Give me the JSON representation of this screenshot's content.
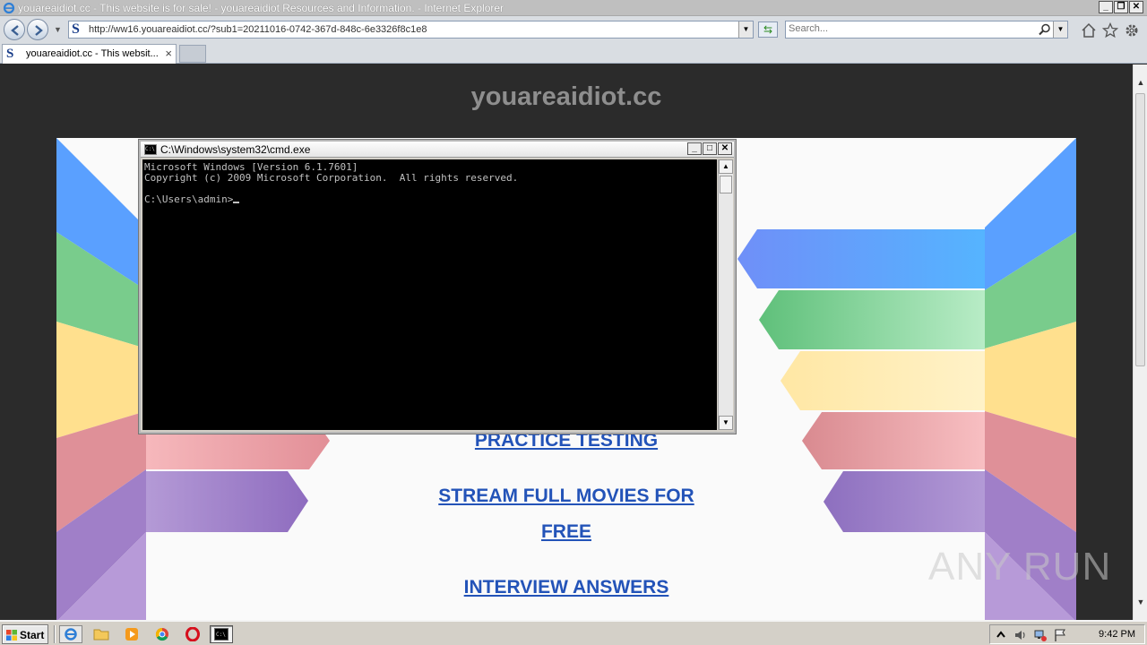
{
  "browser": {
    "window_title": "youareaidiot.cc - This website is for sale! - youareaidiot Resources and Information. - Internet Explorer",
    "address": "http://ww16.youareaidiot.cc/?sub1=20211016-0742-367d-848c-6e3326f8c1e8",
    "search_placeholder": "Search...",
    "tab_title": "youareaidiot.cc - This websit..."
  },
  "page": {
    "site_title": "youareaidiot.cc",
    "links": [
      "PRACTICE TESTING",
      "STREAM FULL MOVIES FOR",
      "FREE",
      "INTERVIEW ANSWERS"
    ]
  },
  "cmd": {
    "title": "C:\\Windows\\system32\\cmd.exe",
    "line1": "Microsoft Windows [Version 6.1.7601]",
    "line2": "Copyright (c) 2009 Microsoft Corporation.  All rights reserved.",
    "prompt": "C:\\Users\\admin>"
  },
  "taskbar": {
    "start_label": "Start",
    "clock": "9:42 PM"
  },
  "watermark": "ANY RUN",
  "colors": {
    "link": "#2353b8",
    "stripe_blue": "#5b9bff",
    "stripe_green": "#7dcf8f",
    "stripe_yellow": "#ffe39a",
    "stripe_red": "#e69aa0",
    "stripe_purple": "#9f7cc4"
  },
  "icons": [
    "ie-logo-icon",
    "back-arrow-icon",
    "forward-arrow-icon",
    "search-icon",
    "home-icon",
    "favorites-star-icon",
    "tools-gear-icon",
    "close-icon",
    "windows-logo-icon",
    "folder-icon",
    "media-player-icon",
    "chrome-icon",
    "opera-icon",
    "cmd-icon",
    "network-icon",
    "volume-icon",
    "flag-icon"
  ]
}
